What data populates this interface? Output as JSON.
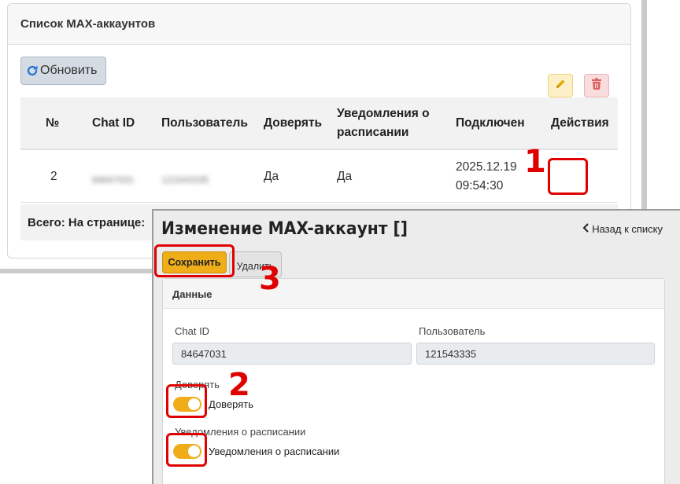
{
  "list": {
    "title": "Список MAX-аккаунтов",
    "refresh_label": "Обновить",
    "columns": [
      "№",
      "Chat ID",
      "Пользователь",
      "Доверять",
      "Уведомления о",
      "расписании",
      "Подключен",
      "Действия"
    ],
    "rows": [
      {
        "num": "2",
        "chat_id": "84647031",
        "user": "121543335",
        "trust": "Да",
        "notify": "Да",
        "connected_date": "2025.12.19",
        "connected_time": "09:54:30"
      }
    ],
    "footer": "Всего:  На странице:"
  },
  "modal": {
    "title": "Изменение MAX-аккаунт []",
    "back_label": "Назад к списку",
    "save_label": "Сохранить",
    "delete_label": "Удалить",
    "section_title": "Данные",
    "chat_id_label": "Chat ID",
    "chat_id_value": "84647031",
    "user_label": "Пользователь",
    "user_value": "121543335",
    "trust_label": "Доверять",
    "trust_switch_label": "Доверять",
    "trust_on": true,
    "notify_label": "Уведомления о расписании",
    "notify_switch_label": "Уведомления о расписании",
    "notify_on": true
  },
  "annotations": [
    "1",
    "2",
    "3"
  ],
  "colors": {
    "accent": "#f0ad1a",
    "highlight": "#e00000",
    "edit_icon": "#e0a800",
    "delete_icon": "#e06060",
    "refresh_icon": "#1e6fd9"
  },
  "icons": {
    "refresh": "refresh-icon",
    "edit": "pencil-icon",
    "delete": "trash-icon",
    "back": "chevron-left-icon"
  }
}
